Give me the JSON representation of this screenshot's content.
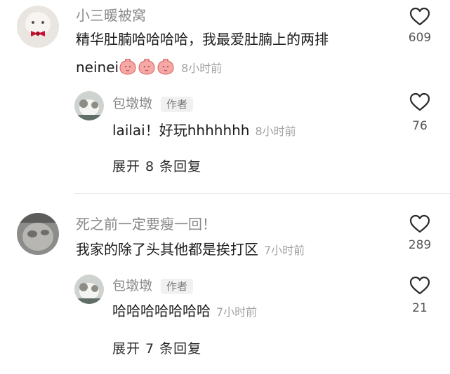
{
  "comments": [
    {
      "username": "小三暖被窝",
      "text_line1": "精华肚腩哈哈哈哈，我最爱肚腩上的两排",
      "text_line2_prefix": "neinei",
      "emojis": [
        "peach-face-emoji",
        "peach-face-emoji",
        "peach-face-emoji"
      ],
      "time": "8小时前",
      "likes": "609",
      "reply": {
        "username": "包墩墩",
        "tag": "作者",
        "text": "lailai！好玩hhhhhhh",
        "time": "8小时前",
        "likes": "76"
      },
      "expand_label": "展开 8 条回复"
    },
    {
      "username": "死之前一定要瘦一回！",
      "text": "我家的除了头其他都是挨打区",
      "time": "7小时前",
      "likes": "289",
      "reply": {
        "username": "包墩墩",
        "tag": "作者",
        "text": "哈哈哈哈哈哈哈",
        "time": "7小时前",
        "likes": "21"
      },
      "expand_label": "展开 7 条回复"
    }
  ],
  "icons": {
    "like": "heart-outline-icon"
  },
  "colors": {
    "username": "#8a8a8a",
    "text": "#1c1c1c",
    "time": "#a3a3a3",
    "divider": "#e6e6e6"
  }
}
